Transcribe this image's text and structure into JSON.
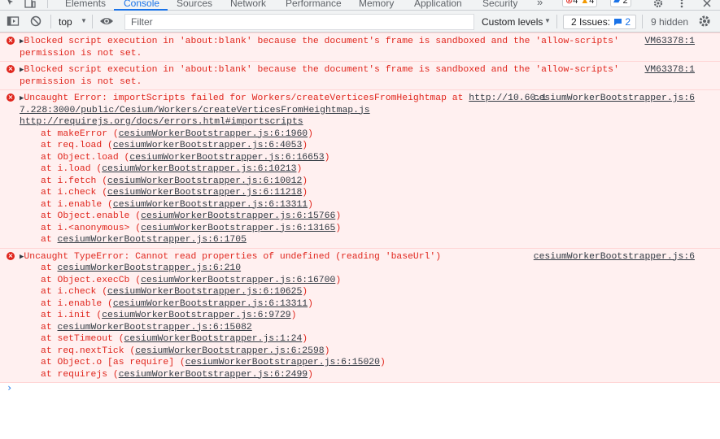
{
  "tabs": [
    {
      "label": "Elements",
      "active": false
    },
    {
      "label": "Console",
      "active": true
    },
    {
      "label": "Sources",
      "active": false
    },
    {
      "label": "Network",
      "active": false
    },
    {
      "label": "Performance",
      "active": false
    },
    {
      "label": "Memory",
      "active": false
    },
    {
      "label": "Application",
      "active": false
    },
    {
      "label": "Security",
      "active": false
    }
  ],
  "tabbar": {
    "more": "»",
    "error_badge": "4",
    "warning_badge": "4",
    "info_badge": "2"
  },
  "toolbar": {
    "context": "top",
    "filter_placeholder": "Filter",
    "levels": "Custom levels",
    "issues_label": "2 Issues:",
    "issues_count": "2",
    "hidden": "9 hidden"
  },
  "messages": [
    {
      "text": "Blocked script execution in 'about:blank' because the document's frame is sandboxed and the 'allow-scripts'",
      "text2": "permission is not set.",
      "source": "VM63378:1"
    },
    {
      "text": "Blocked script execution in 'about:blank' because the document's frame is sandboxed and the 'allow-scripts'",
      "text2": "permission is not set.",
      "source": "VM63378:1"
    },
    {
      "text": "Uncaught Error: importScripts failed for Workers/createVerticesFromHeightmap at ",
      "url1": "http://10.60.1",
      "source": "cesiumWorkerBootstrapper.js:6",
      "url_cont": "7.228:3000/public/Cesium/Workers/createVerticesFromHeightmap.js",
      "url2": "http://requirejs.org/docs/errors.html#importscripts",
      "frames": [
        {
          "fn": "makeError",
          "loc": "cesiumWorkerBootstrapper.js:6:1960"
        },
        {
          "fn": "req.load",
          "loc": "cesiumWorkerBootstrapper.js:6:4053"
        },
        {
          "fn": "Object.load",
          "loc": "cesiumWorkerBootstrapper.js:6:16653"
        },
        {
          "fn": "i.load",
          "loc": "cesiumWorkerBootstrapper.js:6:10213"
        },
        {
          "fn": "i.fetch",
          "loc": "cesiumWorkerBootstrapper.js:6:10012"
        },
        {
          "fn": "i.check",
          "loc": "cesiumWorkerBootstrapper.js:6:11218"
        },
        {
          "fn": "i.enable",
          "loc": "cesiumWorkerBootstrapper.js:6:13311"
        },
        {
          "fn": "Object.enable",
          "loc": "cesiumWorkerBootstrapper.js:6:15766"
        },
        {
          "fn": "i.<anonymous>",
          "loc": "cesiumWorkerBootstrapper.js:6:13165"
        },
        {
          "fn": "",
          "loc": "cesiumWorkerBootstrapper.js:6:1705"
        }
      ]
    },
    {
      "text": "Uncaught TypeError: Cannot read properties of undefined (reading 'baseUrl')",
      "source": "cesiumWorkerBootstrapper.js:6",
      "frames": [
        {
          "fn": "",
          "loc": "cesiumWorkerBootstrapper.js:6:210"
        },
        {
          "fn": "Object.execCb",
          "loc": "cesiumWorkerBootstrapper.js:6:16700"
        },
        {
          "fn": "i.check",
          "loc": "cesiumWorkerBootstrapper.js:6:10625"
        },
        {
          "fn": "i.enable",
          "loc": "cesiumWorkerBootstrapper.js:6:13311"
        },
        {
          "fn": "i.init",
          "loc": "cesiumWorkerBootstrapper.js:6:9729"
        },
        {
          "fn": "",
          "loc": "cesiumWorkerBootstrapper.js:6:15082"
        },
        {
          "fn": "setTimeout",
          "loc": "cesiumWorkerBootstrapper.js:1:24"
        },
        {
          "fn": "req.nextTick",
          "loc": "cesiumWorkerBootstrapper.js:6:2598"
        },
        {
          "fn": "Object.o [as require]",
          "loc": "cesiumWorkerBootstrapper.js:6:15020"
        },
        {
          "fn": "requirejs",
          "loc": "cesiumWorkerBootstrapper.js:6:2499"
        }
      ]
    }
  ],
  "prompt_symbol": "›",
  "colors": {
    "error_text": "#e0261d",
    "error_bg": "#fff0f0",
    "accent": "#1a73e8"
  }
}
